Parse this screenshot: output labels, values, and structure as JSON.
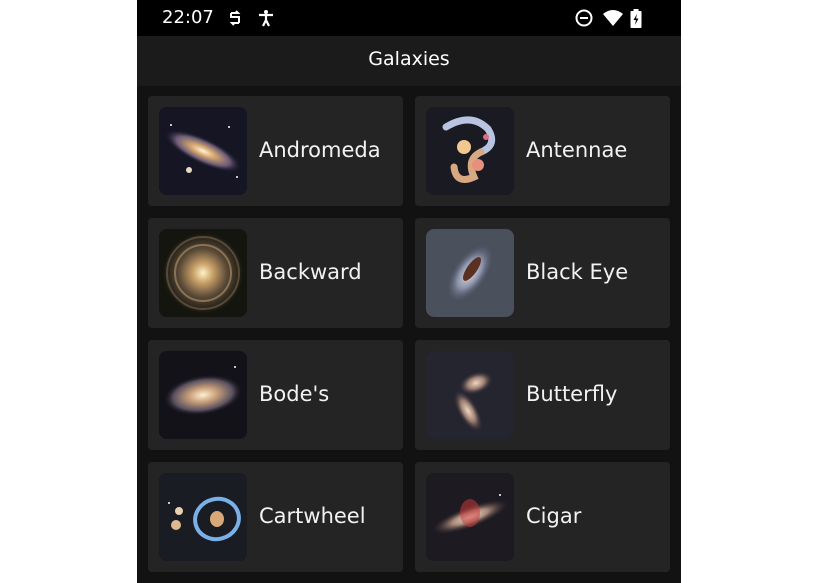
{
  "status_bar": {
    "time": "22:07",
    "left_icons": [
      "sync-icon",
      "accessibility-icon"
    ],
    "right_icons": [
      "do-not-disturb-icon",
      "wifi-icon",
      "battery-charging-icon"
    ]
  },
  "app_bar": {
    "title": "Galaxies"
  },
  "galaxies": [
    {
      "name": "Andromeda",
      "icon": "andromeda-thumbnail"
    },
    {
      "name": "Antennae",
      "icon": "antennae-thumbnail"
    },
    {
      "name": "Backward",
      "icon": "backward-thumbnail"
    },
    {
      "name": "Black Eye",
      "icon": "black-eye-thumbnail"
    },
    {
      "name": "Bode's",
      "icon": "bodes-thumbnail"
    },
    {
      "name": "Butterfly",
      "icon": "butterfly-thumbnail"
    },
    {
      "name": "Cartwheel",
      "icon": "cartwheel-thumbnail"
    },
    {
      "name": "Cigar",
      "icon": "cigar-thumbnail"
    }
  ],
  "colors": {
    "background": "#121212",
    "card": "#242424",
    "status_bar": "#000000",
    "text": "#ffffff"
  }
}
